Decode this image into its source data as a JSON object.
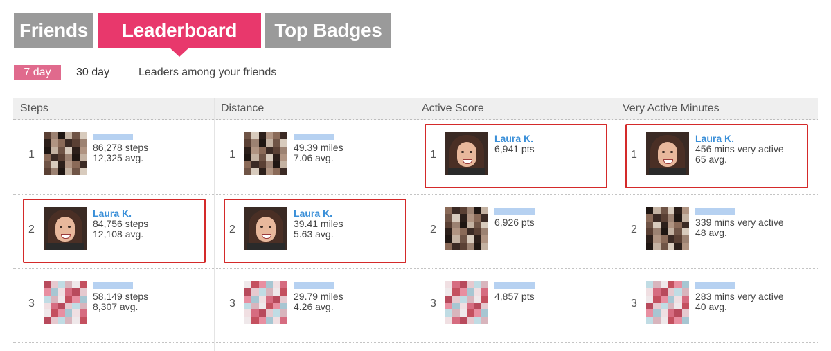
{
  "tabs": {
    "friends": "Friends",
    "leaderboard": "Leaderboard",
    "top_badges": "Top Badges"
  },
  "period": {
    "seven_day": "7 day",
    "thirty_day": "30 day",
    "note": "Leaders among your friends"
  },
  "columns": [
    "Steps",
    "Distance",
    "Active Score",
    "Very Active Minutes"
  ],
  "leaderboard": {
    "steps": [
      {
        "rank": "1",
        "name": "",
        "line1": "86,278 steps",
        "line2": "12,325 avg."
      },
      {
        "rank": "2",
        "name": "Laura K.",
        "line1": "84,756 steps",
        "line2": "12,108 avg."
      },
      {
        "rank": "3",
        "name": "",
        "line1": "58,149 steps",
        "line2": "8,307 avg."
      }
    ],
    "distance": [
      {
        "rank": "1",
        "name": "",
        "line1": "49.39 miles",
        "line2": "7.06 avg."
      },
      {
        "rank": "2",
        "name": "Laura K.",
        "line1": "39.41 miles",
        "line2": "5.63 avg."
      },
      {
        "rank": "3",
        "name": "",
        "line1": "29.79 miles",
        "line2": "4.26 avg."
      }
    ],
    "active_score": [
      {
        "rank": "1",
        "name": "Laura K.",
        "line1": "6,941 pts",
        "line2": ""
      },
      {
        "rank": "2",
        "name": "",
        "line1": "6,926 pts",
        "line2": ""
      },
      {
        "rank": "3",
        "name": "",
        "line1": "4,857 pts",
        "line2": ""
      }
    ],
    "very_active_minutes": [
      {
        "rank": "1",
        "name": "Laura K.",
        "line1": "456 mins very active",
        "line2": "65 avg."
      },
      {
        "rank": "2",
        "name": "",
        "line1": "339 mins very active",
        "line2": "48 avg."
      },
      {
        "rank": "3",
        "name": "",
        "line1": "283 mins very active",
        "line2": "40 avg."
      }
    ]
  },
  "colors": {
    "accent": "#e8386c",
    "tab_inactive": "#9a9a9a",
    "name_link": "#3a8fd8",
    "highlight_box": "#d42a2a"
  }
}
